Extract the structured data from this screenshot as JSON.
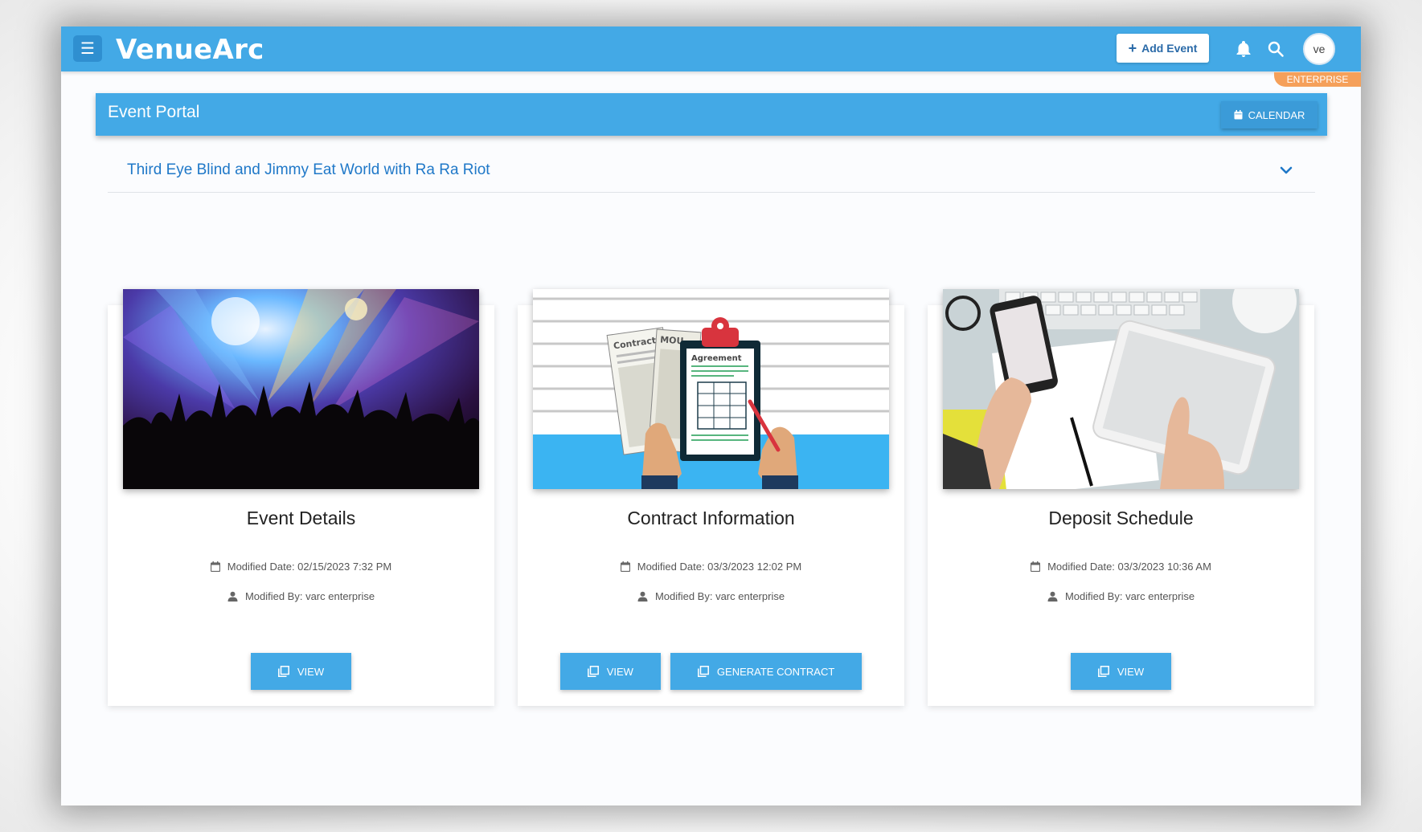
{
  "app": {
    "logo": "VenueArc",
    "add_event_label": "Add Event",
    "avatar_initials": "ve",
    "plan_badge": "ENTERPRISE",
    "accent_color": "#43a9e6"
  },
  "portal": {
    "title": "Event Portal",
    "calendar_label": "CALENDAR",
    "event_name": "Third Eye Blind and Jimmy Eat World with Ra Ra Riot"
  },
  "cards": [
    {
      "title": "Event Details",
      "modified_date": "Modified Date: 02/15/2023 7:32 PM",
      "modified_by": "Modified By: varc enterprise",
      "buttons": [
        "VIEW"
      ]
    },
    {
      "title": "Contract Information",
      "modified_date": "Modified Date: 03/3/2023 12:02 PM",
      "modified_by": "Modified By: varc enterprise",
      "buttons": [
        "VIEW",
        "GENERATE CONTRACT"
      ]
    },
    {
      "title": "Deposit Schedule",
      "modified_date": "Modified Date: 03/3/2023 10:36 AM",
      "modified_by": "Modified By: varc enterprise",
      "buttons": [
        "VIEW"
      ]
    }
  ],
  "illustration_text": {
    "contract": "Contract",
    "mou": "MOU",
    "agreement": "Agreement"
  }
}
